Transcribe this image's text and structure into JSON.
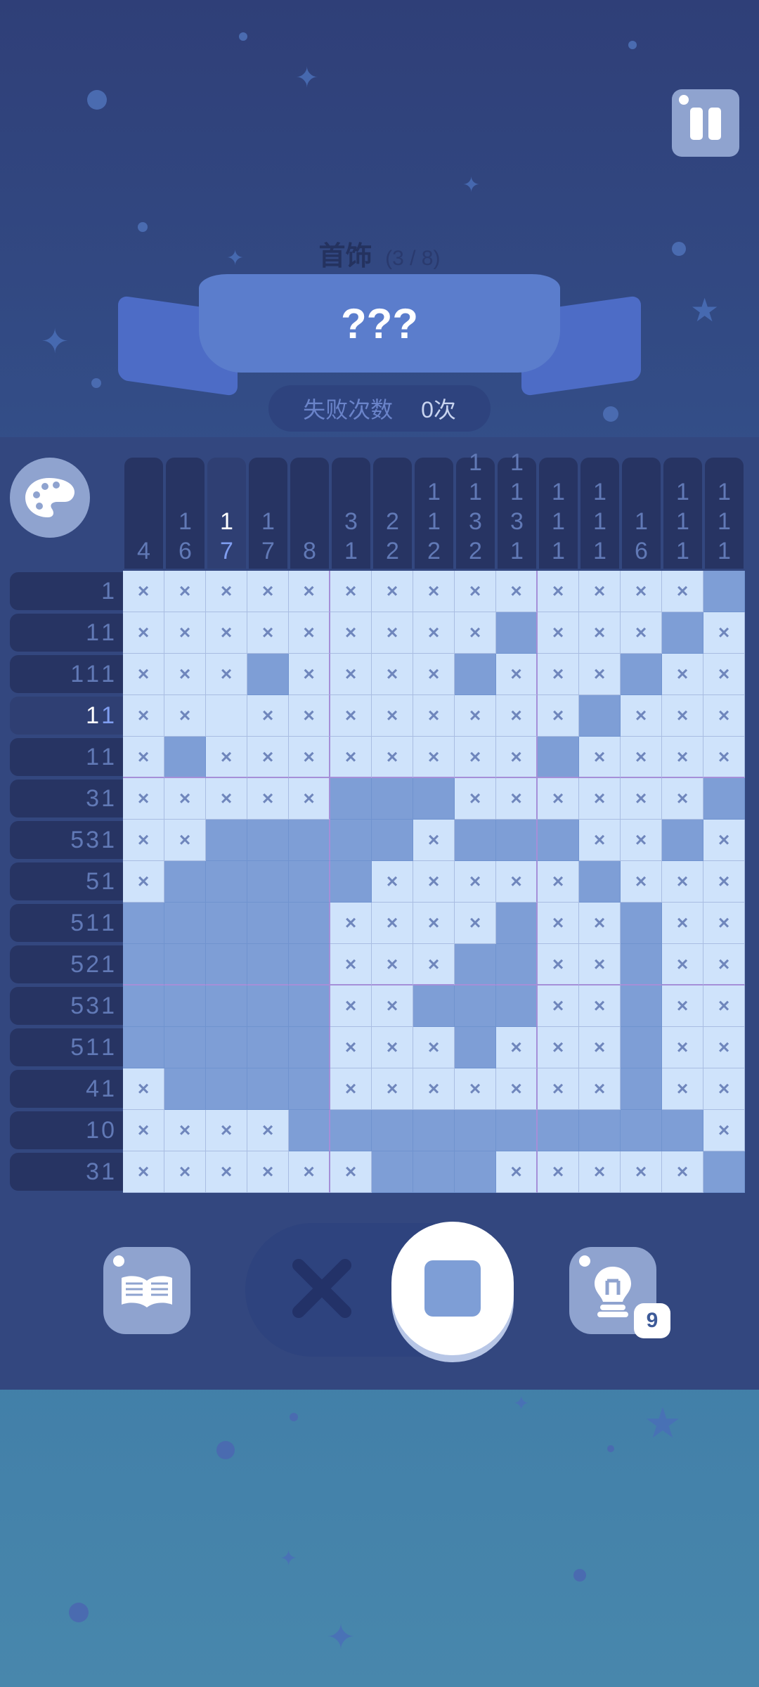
{
  "header": {
    "category": "首饰",
    "progress": "(3 / 8)",
    "title": "???",
    "fail_label": "失败次数",
    "fail_value": "0次"
  },
  "column_clues": [
    [
      "4"
    ],
    [
      "1",
      "6"
    ],
    [
      "1",
      "7"
    ],
    [
      "1",
      "7"
    ],
    [
      "8"
    ],
    [
      "3",
      "1"
    ],
    [
      "2",
      "2"
    ],
    [
      "1",
      "1",
      "2"
    ],
    [
      "1",
      "1",
      "3",
      "2"
    ],
    [
      "1",
      "1",
      "3",
      "1"
    ],
    [
      "1",
      "1",
      "1"
    ],
    [
      "1",
      "1",
      "1"
    ],
    [
      "1",
      "6"
    ],
    [
      "1",
      "1",
      "1"
    ],
    [
      "1",
      "1",
      "1"
    ]
  ],
  "highlighted_column": 2,
  "row_clues": [
    [
      "1"
    ],
    [
      "1",
      "1"
    ],
    [
      "1",
      "1",
      "1"
    ],
    [
      "1",
      "1"
    ],
    [
      "1",
      "1"
    ],
    [
      "3",
      "1"
    ],
    [
      "5",
      "3",
      "1"
    ],
    [
      "5",
      "1"
    ],
    [
      "5",
      "1",
      "1"
    ],
    [
      "5",
      "2",
      "1"
    ],
    [
      "5",
      "3",
      "1"
    ],
    [
      "5",
      "1",
      "1"
    ],
    [
      "4",
      "1"
    ],
    [
      "10"
    ],
    [
      "3",
      "1"
    ]
  ],
  "highlighted_row": 3,
  "grid": [
    "xxxxxxxxxxxxxx#",
    "xxxxxxxxx#xxx#x",
    "xxx#xxxx#xxx#xx",
    "xx.xxxxxxxx#xxx",
    "x#xxxxxxxx#xxxx",
    "xxxxx###xxxxxx#",
    "xx#####x###xx#x",
    "x#####xxxxx#xxx",
    "#####xxxx#xx#xx",
    "#####xxx##xx#xx",
    "#####xx###xx#xx",
    "#####xxx#xxx#xx",
    "x####xxxxxxx#xx",
    "xxxx##########x",
    "xxxxxx###xxxxx#"
  ],
  "cross_glyph": "×",
  "hint_count": "9",
  "mode": "fill",
  "colors": {
    "filled": "#7e9ed6",
    "empty": "#cfe3fb",
    "clue_bg": "#273463",
    "accent": "#7f9df0"
  }
}
